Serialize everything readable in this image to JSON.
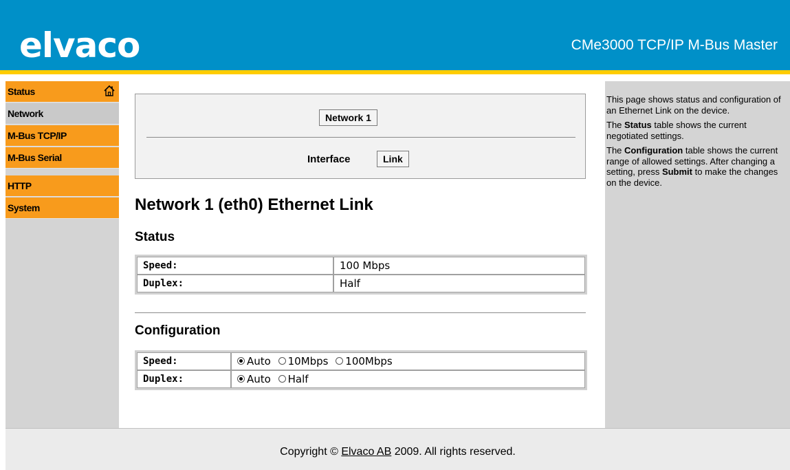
{
  "header": {
    "logo": "elvaco",
    "product": "CMe3000 TCP/IP M-Bus Master"
  },
  "sidebar": {
    "items": [
      {
        "label": "Status"
      },
      {
        "label": "Network"
      },
      {
        "label": "M-Bus TCP/IP"
      },
      {
        "label": "M-Bus Serial"
      },
      {
        "label": "HTTP"
      },
      {
        "label": "System"
      }
    ]
  },
  "selector": {
    "network_button": "Network 1",
    "interface_label": "Interface",
    "interface_button": "Link"
  },
  "main": {
    "title": "Network 1 (eth0) Ethernet Link",
    "status": {
      "heading": "Status",
      "rows": [
        {
          "label": "Speed:",
          "value": "100 Mbps"
        },
        {
          "label": "Duplex:",
          "value": "Half"
        }
      ]
    },
    "configuration": {
      "heading": "Configuration",
      "speed": {
        "label": "Speed:",
        "options": [
          "Auto",
          "10Mbps",
          "100Mbps"
        ],
        "selected": "Auto"
      },
      "duplex": {
        "label": "Duplex:",
        "options": [
          "Auto",
          "Half"
        ],
        "selected": "Auto"
      }
    }
  },
  "help": {
    "p1": "This page shows status and configuration of an Ethernet Link on the device.",
    "p2_pre": "The ",
    "p2_bold": "Status",
    "p2_post": " table shows the current negotiated settings.",
    "p3_pre": "The ",
    "p3_bold": "Configuration",
    "p3_mid": " table shows the current range of allowed settings. After changing a setting, press ",
    "p3_bold2": "Submit",
    "p3_post": " to make the changes on the device."
  },
  "footer": {
    "pre": "Copyright © ",
    "link": "Elvaco AB",
    "post": " 2009. All rights reserved."
  },
  "colors": {
    "header_bg": "#0090c8",
    "accent": "#ffcc00",
    "nav_orange": "#f89b1c",
    "panel_gray": "#d4d4d4"
  },
  "icons": {
    "status_item": "home-icon"
  }
}
